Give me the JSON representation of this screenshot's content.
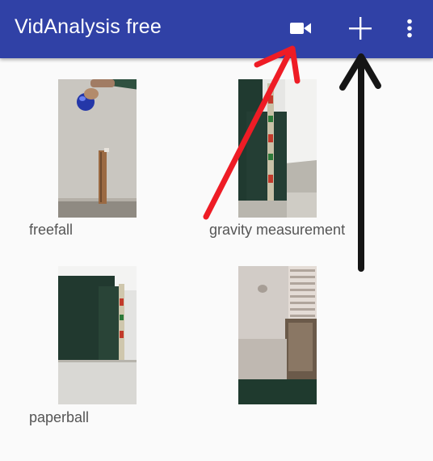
{
  "app_bar": {
    "title": "VidAnalysis free",
    "background_color": "#3041a6",
    "actions": [
      {
        "icon": "video-camera-icon"
      },
      {
        "icon": "plus-icon"
      },
      {
        "icon": "more-vert-icon"
      }
    ]
  },
  "videos": [
    {
      "label": "freefall"
    },
    {
      "label": "gravity measurement"
    },
    {
      "label": "paperball"
    },
    {
      "label": ""
    }
  ],
  "annotations": {
    "red_arrow_color": "#ee1c25",
    "black_arrow_color": "#151515"
  }
}
